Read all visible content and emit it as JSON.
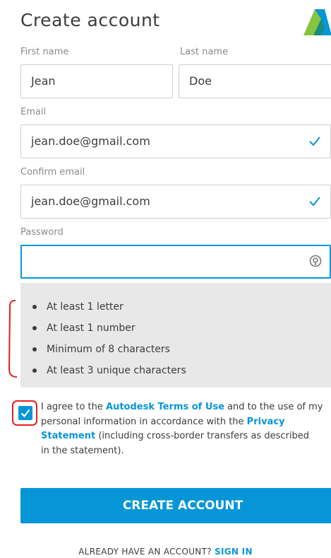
{
  "header": {
    "title": "Create account"
  },
  "form": {
    "first_name": {
      "label": "First name",
      "value": "Jean"
    },
    "last_name": {
      "label": "Last name",
      "value": "Doe"
    },
    "email": {
      "label": "Email",
      "value": "jean.doe@gmail.com",
      "valid": true
    },
    "confirm_email": {
      "label": "Confirm email",
      "value": "jean.doe@gmail.com",
      "valid": true
    },
    "password": {
      "label": "Password",
      "value": "",
      "focused": true
    }
  },
  "password_rules": [
    "At least 1 letter",
    "At least 1 number",
    "Minimum of 8 characters",
    "At least 3 unique characters"
  ],
  "terms": {
    "checked": true,
    "text_1": "I agree to the ",
    "terms_link": "Autodesk Terms of Use",
    "text_2": " and to the use of my",
    "text_3": "personal information in accordance with the ",
    "privacy_link_1": "Privacy",
    "privacy_link_2": "Statement",
    "text_4": " (including cross-border transfers as described",
    "text_5": "in the statement)."
  },
  "actions": {
    "create_label": "CREATE ACCOUNT",
    "signin_prompt": "ALREADY HAVE AN ACCOUNT? ",
    "signin_link": "SIGN IN"
  },
  "icons": {
    "logo": "autodesk-logo",
    "valid": "check-icon",
    "password_toggle": "eye-icon"
  },
  "colors": {
    "accent": "#0696d7",
    "annotation": "#e0201f",
    "rules_background": "#e8e8e8"
  }
}
